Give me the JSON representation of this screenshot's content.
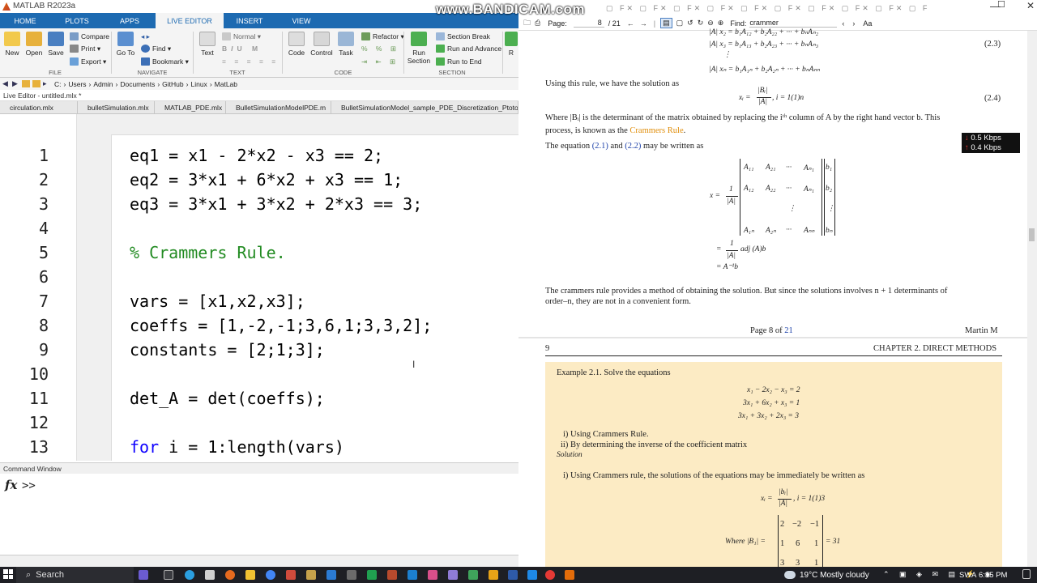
{
  "window": {
    "title": "MATLAB R2023a",
    "watermark": "www.BANDICAM.com"
  },
  "tabs": [
    "HOME",
    "PLOTS",
    "APPS",
    "LIVE EDITOR",
    "INSERT",
    "VIEW"
  ],
  "ribbon": {
    "file": {
      "new": "New",
      "open": "Open",
      "save": "Save",
      "compare": "Compare",
      "print": "Print",
      "export": "Export",
      "group": "FILE"
    },
    "navigate": {
      "goto": "Go To",
      "find": "Find",
      "bookmark": "Bookmark",
      "group": "NAVIGATE"
    },
    "text": {
      "text": "Text",
      "style": "Normal",
      "group": "TEXT"
    },
    "code": {
      "refactor": "Refactor",
      "code": "Code",
      "control": "Control",
      "task": "Task",
      "group": "CODE"
    },
    "section": {
      "run_section": "Run Section",
      "section_break": "Section Break",
      "run_advance": "Run and Advance",
      "run_end": "Run to End",
      "group": "SECTION"
    },
    "cut": "R"
  },
  "address": [
    "C:",
    "Users",
    "Admin",
    "Documents",
    "GitHub",
    "Linux",
    "MatLab"
  ],
  "live_editor_label": "Live Editor - untitled.mlx *",
  "doc_tabs": [
    "circulation.mlx",
    "bulletSimulation.mlx",
    "MATLAB_PDE.mlx",
    "BulletSimulationModelPDE.m",
    "BulletSimulationModel_sample_PDE_Discretization_Ptototype.m"
  ],
  "code": [
    {
      "n": "1",
      "text": "eq1 = x1 - 2*x2 - x3 == 2;"
    },
    {
      "n": "2",
      "text": "eq2 = 3*x1 + 6*x2 + x3 == 1;"
    },
    {
      "n": "3",
      "text": "eq3 = 3*x1 + 3*x2 + 2*x3 == 3;"
    },
    {
      "n": "4",
      "text": ""
    },
    {
      "n": "5",
      "text": "% Crammers Rule."
    },
    {
      "n": "6",
      "text": ""
    },
    {
      "n": "7",
      "text": "vars = [x1,x2,x3];"
    },
    {
      "n": "8",
      "text": "coeffs = [1,-2,-1;3,6,1;3,3,2];"
    },
    {
      "n": "9",
      "text": "constants = [2;1;3];"
    },
    {
      "n": "10",
      "text": ""
    },
    {
      "n": "11",
      "text": "det_A = det(coeffs);"
    },
    {
      "n": "12",
      "text": ""
    },
    {
      "n": "13",
      "kw": "for",
      "text": " i = 1:length(vars)"
    }
  ],
  "command_window": {
    "label": "Command Window",
    "fx": "fx",
    "prompt": ">>"
  },
  "pdf": {
    "page_label": "Page:",
    "page": "8",
    "page_total": "/ 21",
    "find_label": "Find:",
    "find_value": "crammer",
    "aa": "Aa",
    "eq_top1": "|A| x₂ = b₁A₁₂ + b₂A₂₂ + ··· + bₙAₙ₂",
    "eq_top2": "|A| x₃ = b₁A₁₃ + b₂A₂₃ + ··· + bₙAₙ₃",
    "eq_dots": "⋮",
    "eq_top3": "|A| xₙ = b₁A₁ₙ + b₂A₂ₙ + ··· + bₙAₙₙ",
    "eqno_23": "(2.3)",
    "using_rule": "Using this rule, we have the solution as",
    "eq_sol_lhs": "xᵢ =",
    "eq_sol_num": "|Bᵢ|",
    "eq_sol_den": "|A|",
    "eq_sol_rhs": ", i = 1(1)n",
    "eqno_24": "(2.4)",
    "where_line1": "Where |Bᵢ| is the determinant of the matrix obtained by replacing the iᵗʰ column of A by the right hand vector b.  This",
    "where_line2a": "process, is known as the",
    "crammers_rule": "Crammers Rule",
    "period": ".",
    "eq_written_a": "The equation",
    "ref_21": "(2.1)",
    "and": "and",
    "ref_22": "(2.2)",
    "eq_written_b": "may be written as",
    "mat_x": "x =",
    "mat_one": "1",
    "mat_absA": "|A|",
    "mat_rows": [
      [
        "A₁₁",
        "A₂₁",
        "···",
        "Aₙ₁"
      ],
      [
        "A₁₂",
        "A₂₂",
        "···",
        "Aₙ₁"
      ],
      [
        "",
        "",
        "⋮",
        ""
      ],
      [
        "A₁ₙ",
        "A₂ₙ",
        "···",
        "Aₙₙ"
      ]
    ],
    "vec_b": [
      "b₁",
      "b₂",
      "⋮",
      "bₙ"
    ],
    "adj_line": "adj (A)b",
    "ainv_line": "= A⁻¹b",
    "para1": "The crammers rule provides a method of obtaining the solution.  But since the solutions involves n + 1 determinants of",
    "para2": "order–n, they are not in a convenient form.",
    "footer_page_a": "Page 8 of",
    "footer_page_b": "21",
    "footer_author": "Martin M",
    "header_num": "9",
    "header_chapter": "CHAPTER 2.  DIRECT METHODS",
    "example_title": "Example 2.1.  Solve the equations",
    "ex_eq1": "x₁ − 2x₂ − x₃ = 2",
    "ex_eq2": "3x₁ + 6x₂ + x₃ = 1",
    "ex_eq3": "3x₁ + 3x₂ + 2x₃ = 3",
    "ex_i": "i)   Using Crammers Rule.",
    "ex_ii": "ii)   By determining the inverse of the coefficient matrix",
    "solution": "Solution",
    "sol_i": "i)   Using Crammers rule, the solutions of the equations may be immediately be written as",
    "sol_eq_lhs": "xᵢ =",
    "sol_eq_num": "|bᵢ|",
    "sol_eq_den": "|A|",
    "sol_eq_rhs": ", i = 1(1)3",
    "where_b1": "Where |B₁| =",
    "b1_rows": [
      [
        "2",
        "−2",
        "−1"
      ],
      [
        "1",
        "6",
        "1"
      ],
      [
        "3",
        "3",
        "1"
      ]
    ],
    "b1_value": "= 31"
  },
  "network": {
    "down": "0.5 Kbps",
    "up": "0.4 Kbps"
  },
  "taskbar": {
    "search": "Search",
    "weather": "19°C  Mostly cloudy",
    "lang": "SWA",
    "time": "6:15 PM"
  },
  "colors": {
    "ribbon_blue": "#1d6ab1",
    "comment_green": "#228b22",
    "keyword_blue": "#0e00ff",
    "link_orange": "#e08e0b",
    "example_bg": "#fcebc4"
  }
}
